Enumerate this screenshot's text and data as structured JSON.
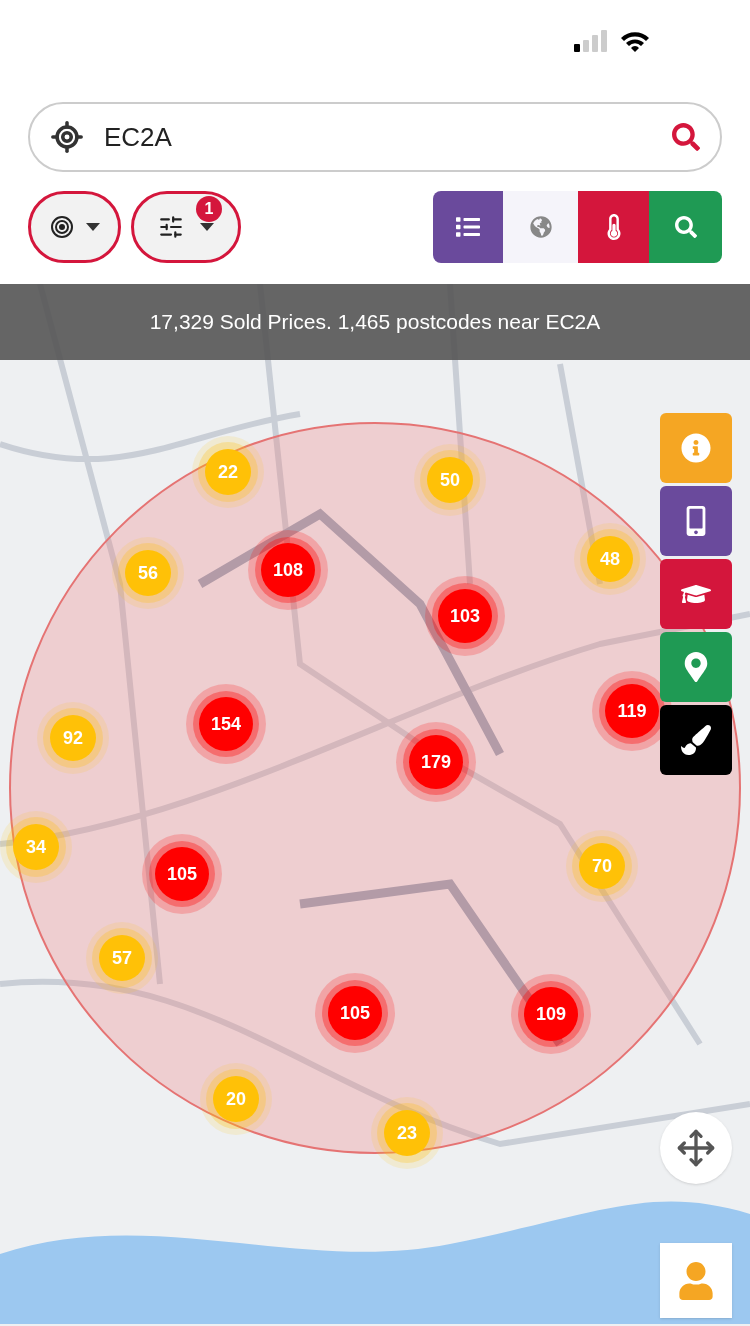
{
  "search": {
    "value": "EC2A"
  },
  "filter": {
    "badge": "1"
  },
  "banner": {
    "text": "17,329 Sold Prices. 1,465 postcodes near EC2A"
  },
  "clusters": [
    {
      "count": "22",
      "color": "#ffc107"
    },
    {
      "count": "50",
      "color": "#ffc107"
    },
    {
      "count": "56",
      "color": "#ffc107"
    },
    {
      "count": "108",
      "color": "#ff0000"
    },
    {
      "count": "48",
      "color": "#ffc107"
    },
    {
      "count": "103",
      "color": "#ff0000"
    },
    {
      "count": "92",
      "color": "#ffc107"
    },
    {
      "count": "154",
      "color": "#ff0000"
    },
    {
      "count": "119",
      "color": "#ff0000"
    },
    {
      "count": "179",
      "color": "#ff0000"
    },
    {
      "count": "34",
      "color": "#ffc107"
    },
    {
      "count": "105",
      "color": "#ff0000"
    },
    {
      "count": "70",
      "color": "#ffc107"
    },
    {
      "count": "57",
      "color": "#ffc107"
    },
    {
      "count": "105",
      "color": "#ff0000"
    },
    {
      "count": "109",
      "color": "#ff0000"
    },
    {
      "count": "20",
      "color": "#ffc107"
    },
    {
      "count": "23",
      "color": "#ffc107"
    }
  ]
}
